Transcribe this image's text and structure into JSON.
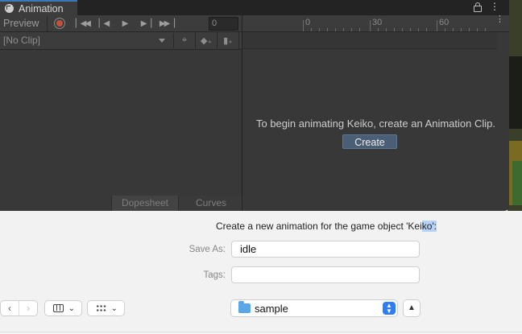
{
  "window": {
    "tab_title": "Animation",
    "icons": {
      "lock": "lock-icon",
      "more": "more-vertical-icon"
    }
  },
  "toolbar": {
    "preview_label": "Preview",
    "record_icon": "record-icon",
    "buttons": [
      "first-key-icon",
      "prev-key-icon",
      "play-icon",
      "next-key-icon",
      "last-key-icon"
    ],
    "frame_value": "0"
  },
  "clip_selector": {
    "value": "[No Clip]",
    "buttons": [
      "add-keyframe-target-icon",
      "add-keyframe-icon",
      "add-event-icon"
    ]
  },
  "timeline": {
    "ticks": [
      "0",
      "30",
      "60"
    ]
  },
  "empty_state": {
    "message": "To begin animating Keiko, create an Animation Clip.",
    "create_label": "Create"
  },
  "bottom_tabs": [
    "Dopesheet",
    "Curves"
  ],
  "dialog": {
    "prompt_prefix": "Create a new animation for the game object 'Kei",
    "prompt_highlight": "ko':",
    "save_as_label": "Save As:",
    "save_as_value": "idle",
    "tags_label": "Tags:",
    "tags_value": "",
    "location_folder": "sample",
    "colors": {
      "folder": "#5aa6e6",
      "stepper": "#2f7cf6",
      "selection": "#b6d3f5"
    }
  },
  "colors": {
    "editor_bg": "#383838",
    "accent_tab": "#3a79bb",
    "create_button": "#4a5e76",
    "record": "#c4523a"
  }
}
